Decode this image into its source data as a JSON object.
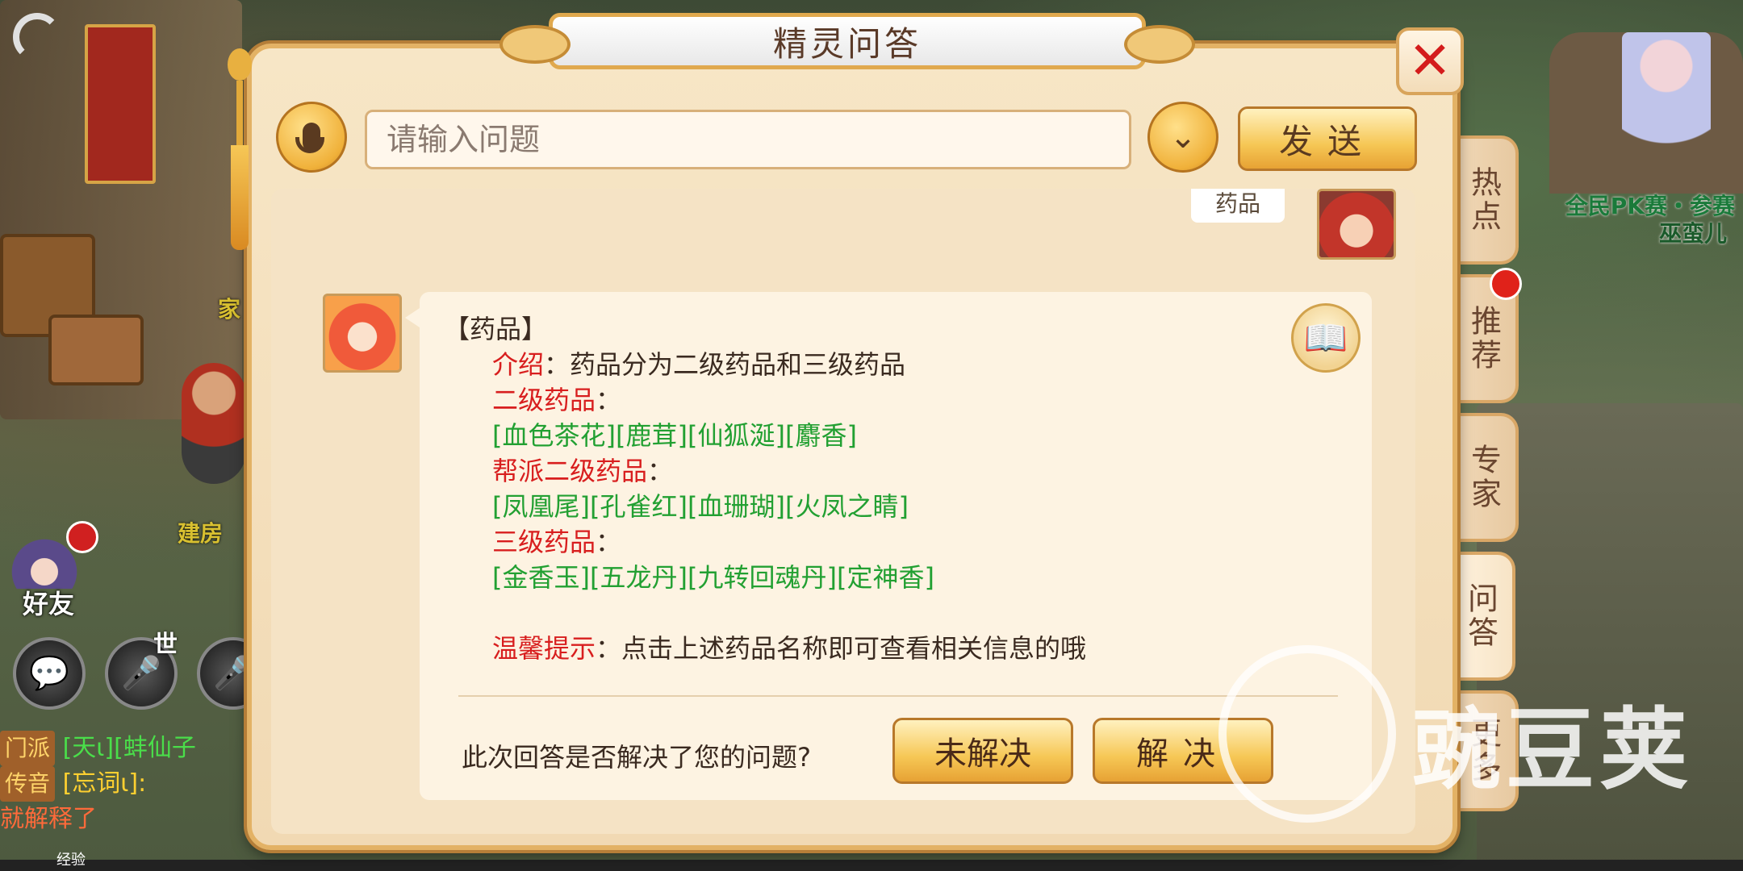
{
  "dialog": {
    "title": "精灵问答",
    "close_glyph": "✕",
    "input_placeholder": "请输入问题",
    "dropdown_glyph": "⌄",
    "send_label": "发送"
  },
  "side_tabs": [
    "热点",
    "推荐",
    "专家",
    "问答",
    "更多"
  ],
  "previous_message": "药品",
  "answer": {
    "heading": "【药品】",
    "intro_label": "介绍",
    "intro_sep": "：",
    "intro_text": "药品分为二级药品和三级药品",
    "level2_label": "二级药品",
    "level2_items": [
      "[血色茶花]",
      "[鹿茸]",
      "[仙狐涎]",
      "[麝香]"
    ],
    "guild_level2_label": "帮派二级药品",
    "guild_level2_items": [
      "[凤凰尾]",
      "[孔雀红]",
      "[血珊瑚]",
      "[火凤之睛]"
    ],
    "level3_label": "三级药品",
    "level3_items": [
      "[金香玉]",
      "[五龙丹]",
      "[九转回魂丹]",
      "[定神香]"
    ],
    "colon": "：",
    "tip_label": "温馨提示",
    "tip_text": "点击上述药品名称即可查看相关信息的哦"
  },
  "feedback": {
    "question": "此次回答是否解决了您的问题?",
    "unresolved_label": "未解决",
    "resolved_label": "解决"
  },
  "game_hud": {
    "pk_text": "全民PK赛・参赛",
    "npc_name": "巫蛮儿",
    "home_text": "家",
    "build_text": "建房",
    "friend_label": "好友",
    "world_tag": "世",
    "chat_lines": [
      {
        "channel": "门派",
        "text": "[天ι][蚌仙子"
      },
      {
        "channel": "传音",
        "text": "[忘词ι]:"
      },
      {
        "channel": "",
        "text": "就解释了"
      }
    ],
    "exp_label": "经验"
  },
  "watermark": "豌豆荚",
  "colors": {
    "accent_gold": "#f6c755",
    "title_brown": "#5a3a28",
    "label_red": "#d81e1e",
    "item_green": "#22a032",
    "close_red": "#d41c1c"
  }
}
